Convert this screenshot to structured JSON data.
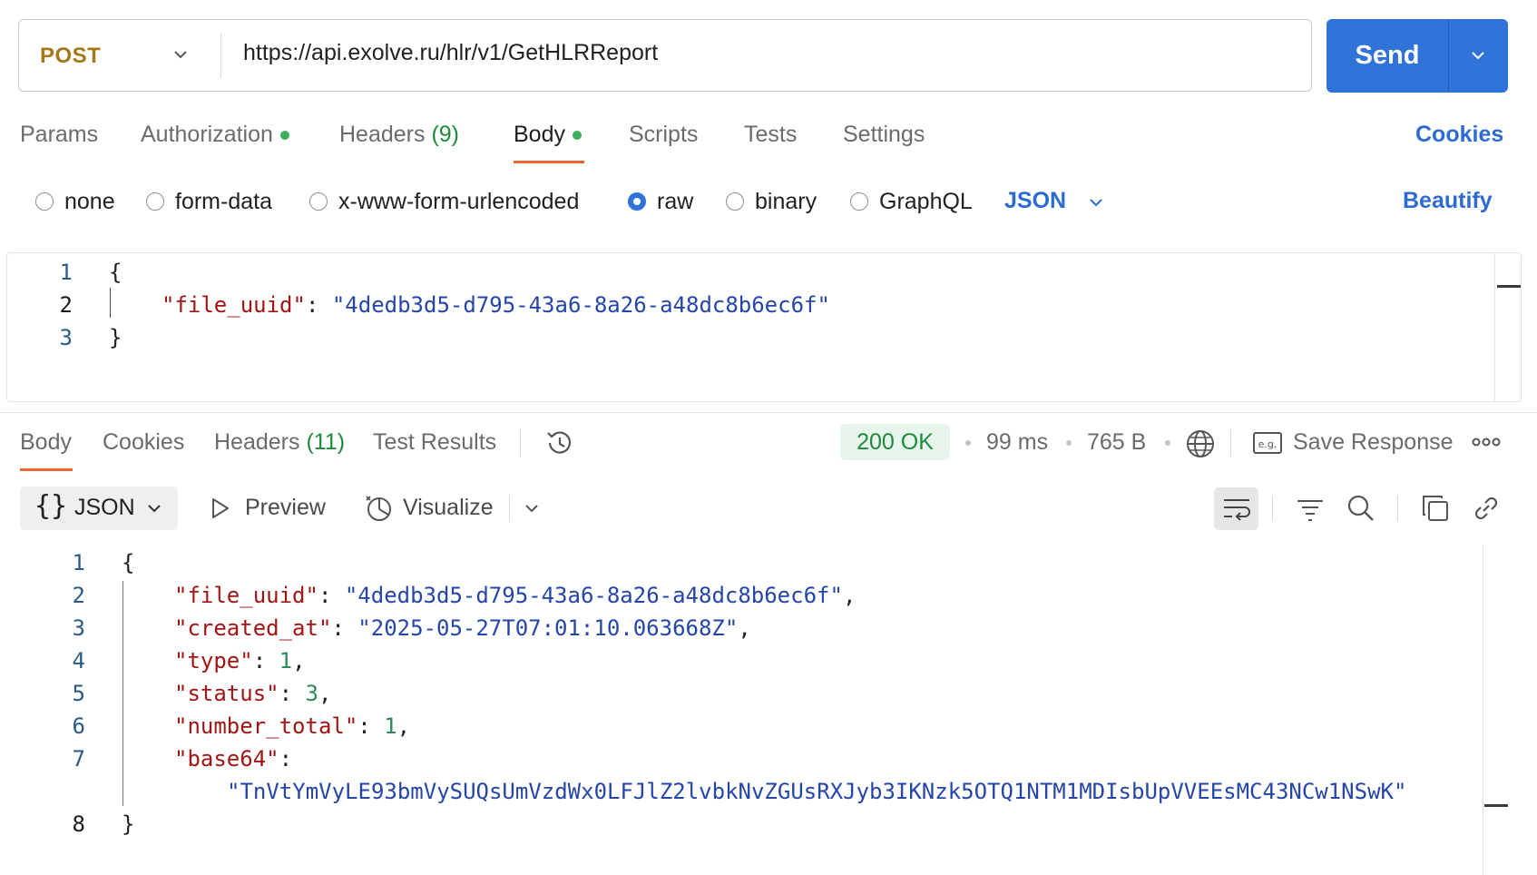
{
  "request": {
    "method": "POST",
    "url": "https://api.exolve.ru/hlr/v1/GetHLRReport",
    "send_label": "Send"
  },
  "request_tabs": {
    "params": "Params",
    "authorization": "Authorization",
    "headers": "Headers",
    "headers_count": "(9)",
    "body": "Body",
    "scripts": "Scripts",
    "tests": "Tests",
    "settings": "Settings",
    "cookies": "Cookies",
    "active": "Body"
  },
  "body_types": {
    "none": "none",
    "form_data": "form-data",
    "urlencoded": "x-www-form-urlencoded",
    "raw": "raw",
    "binary": "binary",
    "graphql": "GraphQL",
    "selected": "raw",
    "format": "JSON",
    "beautify": "Beautify"
  },
  "request_body": {
    "line_numbers": [
      "1",
      "2",
      "3"
    ],
    "open": "{",
    "key": "\"file_uuid\"",
    "colon": ": ",
    "value": "\"4dedb3d5-d795-43a6-8a26-a48dc8b6ec6f\"",
    "close": "}"
  },
  "response_tabs": {
    "body": "Body",
    "cookies": "Cookies",
    "headers": "Headers",
    "headers_count": "(11)",
    "test_results": "Test Results",
    "active": "Body"
  },
  "response_meta": {
    "status": "200 OK",
    "time": "99 ms",
    "size": "765 B",
    "save_response": "Save Response"
  },
  "response_toolbar": {
    "format": "JSON",
    "preview": "Preview",
    "visualize": "Visualize"
  },
  "response_body": {
    "line_numbers": [
      "1",
      "2",
      "3",
      "4",
      "5",
      "6",
      "7",
      "8"
    ],
    "open": "{",
    "close": "}",
    "fields": [
      {
        "key": "\"file_uuid\"",
        "value": "\"4dedb3d5-d795-43a6-8a26-a48dc8b6ec6f\"",
        "trail": ","
      },
      {
        "key": "\"created_at\"",
        "value": "\"2025-05-27T07:01:10.063668Z\"",
        "trail": ","
      },
      {
        "key": "\"type\"",
        "value": "1",
        "trail": ","
      },
      {
        "key": "\"status\"",
        "value": "3",
        "trail": ","
      },
      {
        "key": "\"number_total\"",
        "value": "1",
        "trail": ","
      },
      {
        "key": "\"base64\"",
        "value": "\"TnVtYmVyLE93bmVySUQsUmVzdWx0LFJlZ2lvbkNvZGUsRXJyb3IKNzk5OTQ1NTM1MDIsbUpVVEEsMC43NCw1NSwK\"",
        "trail": ""
      }
    ]
  },
  "icons": {
    "method_dropdown": "chevron-down-icon",
    "send_dropdown": "chevron-down-icon",
    "history": "history-icon",
    "globe": "globe-icon",
    "save_example": "eg-icon",
    "more": "more-icon",
    "preview": "play-icon",
    "visualize": "visualize-icon",
    "wrap": "wrap-lines-icon",
    "filter": "filter-icon",
    "search": "search-icon",
    "copy": "copy-icon",
    "link": "link-icon"
  },
  "colors": {
    "accent": "#2f73d9",
    "method": "#a5791a",
    "tab_underline": "#e8672c",
    "status_ok": "#1e8a3b",
    "json_key": "#a31515",
    "json_string": "#2545a8",
    "json_number": "#2e8b57"
  }
}
